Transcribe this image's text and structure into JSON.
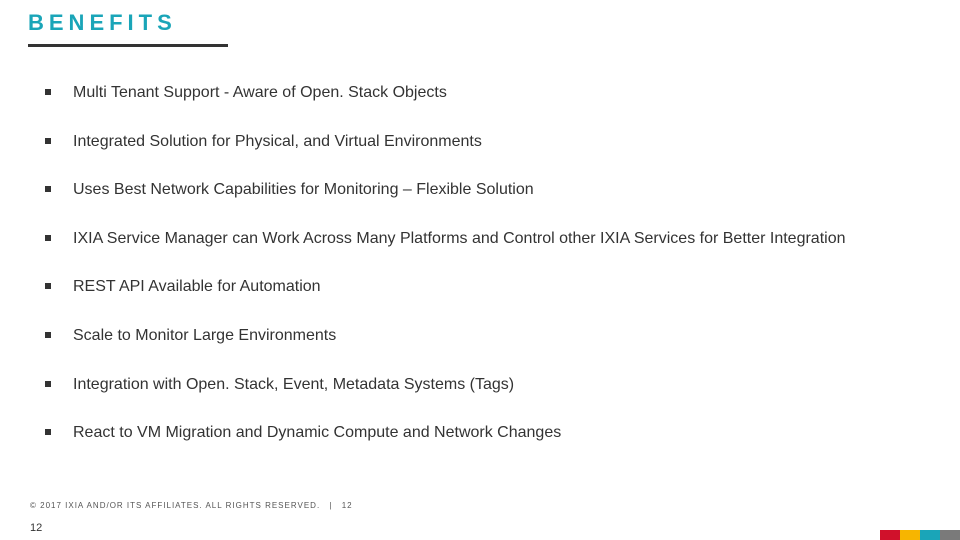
{
  "title": "BENEFITS",
  "bullets": [
    "Multi Tenant Support - Aware of Open. Stack Objects",
    "Integrated Solution for Physical, and Virtual Environments",
    "Uses Best Network Capabilities for Monitoring – Flexible Solution",
    "IXIA Service Manager can Work Across Many Platforms and Control other IXIA Services for Better Integration",
    "REST API Available for Automation",
    "Scale to Monitor Large Environments",
    "Integration with Open. Stack, Event, Metadata Systems (Tags)",
    "React to VM Migration and Dynamic Compute and Network Changes"
  ],
  "footer": {
    "copyright": "© 2017 IXIA AND/OR ITS AFFILIATES. ALL RIGHTS RESERVED.",
    "separator": "|",
    "page": "12"
  },
  "page_bottom": "12"
}
